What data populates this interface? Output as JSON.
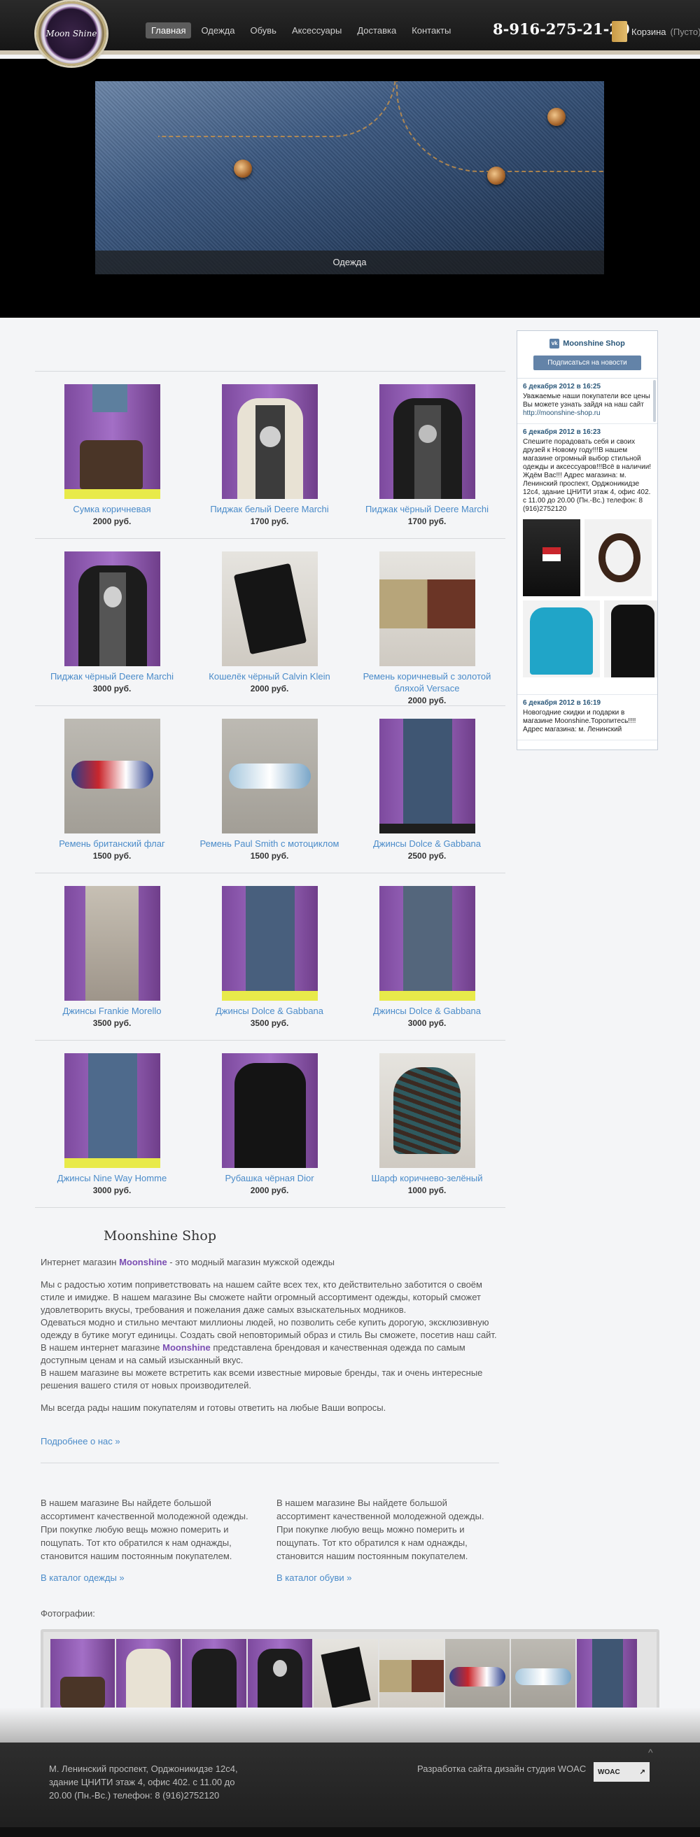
{
  "header": {
    "logo_text": "Moon Shine",
    "nav": [
      "Главная",
      "Одежда",
      "Обувь",
      "Аксессуары",
      "Доставка",
      "Контакты"
    ],
    "phone": "8-916-275-21-20",
    "cart_label": "Корзина",
    "cart_status": "(Пусто)"
  },
  "banner": {
    "caption": "Одежда"
  },
  "products": [
    {
      "name": "Сумка коричневая",
      "price": "2000 руб."
    },
    {
      "name": "Пиджак белый Deere Marchi",
      "price": "1700 руб."
    },
    {
      "name": "Пиджак чёрный Deere Marchi",
      "price": "1700 руб."
    },
    {
      "name": "Пиджак чёрный Deere Marchi",
      "price": "3000 руб."
    },
    {
      "name": "Кошелёк чёрный Calvin Klein",
      "price": "2000 руб."
    },
    {
      "name": "Ремень коричневый с золотой бляхой Versace",
      "price": "2000 руб."
    },
    {
      "name": "Ремень британский флаг",
      "price": "1500 руб."
    },
    {
      "name": "Ремень Paul Smith с мотоциклом",
      "price": "1500 руб."
    },
    {
      "name": "Джинсы Dolce & Gabbana",
      "price": "2500 руб."
    },
    {
      "name": "Джинсы Frankie Morello",
      "price": "3500 руб."
    },
    {
      "name": "Джинсы Dolce & Gabbana",
      "price": "3500 руб."
    },
    {
      "name": "Джинсы Dolce & Gabbana",
      "price": "3000 руб."
    },
    {
      "name": "Джинсы Nine Way Homme",
      "price": "3000 руб."
    },
    {
      "name": "Рубашка чёрная Dior",
      "price": "2000 руб."
    },
    {
      "name": "Шарф коричнево-зелёный",
      "price": "1000 руб."
    }
  ],
  "about": {
    "title": "Moonshine Shop",
    "intro_prefix": "Интернет магазин ",
    "brand": "Moonshine",
    "intro_suffix": "  - это модный магазин мужской одежды",
    "para1": "Мы с радостью хотим поприветствовать на нашем сайте всех тех, кто действительно заботится о своём стиле и имидже. В нашем магазине  Вы сможете найти огромный ассортимент одежды, который сможет удовлетворить вкусы, требования и пожелания даже самых взыскательных модников.",
    "para2": "Одеваться модно и стильно мечтают миллионы людей, но позволить себе купить дорогую, эксклюзивную одежду в бутике могут единицы. Создать свой неповторимый образ и стиль Вы сможете, посетив наш сайт.",
    "para3_prefix": "В нашем интернет магазине ",
    "para3_suffix": " представлена брендовая и качественная одежда по самым доступным ценам и на самый изысканный вкус.",
    "para4": "В нашем магазине вы можете встретить как  всеми известные мировые бренды, так и очень интересные решения вашего стиля от новых производителей.",
    "para5": "Мы всегда рады нашим покупателям и готовы ответить на любые Ваши вопросы.",
    "more": "Подробнее о нас »"
  },
  "columns": [
    {
      "text": "В нашем магазине Вы найдете большой ассортимент качественной молодежной одежды. При покупке любую вещь можно померить и пощупать. Тот кто обратился к нам однажды, становится нашим постоянным покупателем.",
      "link": "В каталог одежды »"
    },
    {
      "text": "В нашем магазине Вы найдете большой ассортимент качественной молодежной одежды. При покупке любую вещь можно померить и пощупать. Тот кто обратился к нам однажды, становится нашим постоянным покупателем.",
      "link": "В каталог обуви »"
    }
  ],
  "photos_label": "Фотографии:",
  "vk": {
    "title": "Moonshine Shop",
    "subscribe": "Подписаться на новости",
    "posts": [
      {
        "date": "6 декабря 2012 в 16:25",
        "text": "Уважаемые наши покупатели все цены Вы можете узнать зайдя на наш сайт",
        "link": "http://moonshine-shop.ru"
      },
      {
        "date": "6 декабря 2012 в 16:23",
        "text": "Спешите порадовать себя и своих друзей к Новому году!!!В нашем магазине огромный выбор стильной одежды и аксессуаров!!!Всё в наличии! Ждём Вас!!! Адрес магазина: м. Ленинский проспект, Орджоникидзе 12с4, здание ЦНИТИ этаж 4, офис 402. с 11.00 до 20.00 (Пн.-Вс.) телефон: 8 (916)2752120"
      },
      {
        "date": "6 декабря 2012 в 16:19",
        "text": "Новогодние скидки и подарки в магазине Moonshine.Торопитесь!!!! Адрес магазина: м. Ленинский"
      }
    ]
  },
  "footer": {
    "address": "М. Ленинский проспект, Орджоникидзе 12с4, здание ЦНИТИ этаж 4, офис 402. с 11.00 до 20.00 (Пн.-Вс.) телефон: 8 (916)2752120",
    "credit": "Разработка сайта дизайн студия WOAC",
    "studio_logo": "WOAC",
    "to_top": "^"
  },
  "colors": {
    "accent_link": "#4a8bc9",
    "brand": "#7a4eb2",
    "header_bg": "#1e1e1e",
    "nav_active": "#5c5c5c"
  },
  "icons": [
    "cart-icon",
    "vk-logo-icon",
    "scroll-top-icon"
  ]
}
